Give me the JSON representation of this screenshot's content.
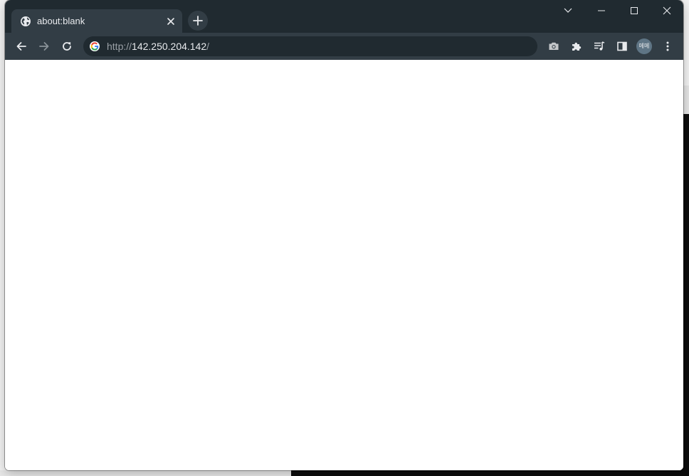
{
  "browser": {
    "tab": {
      "title": "about:blank",
      "favicon": "globe-icon"
    },
    "omnibox": {
      "scheme": "http://",
      "host": "142.250.204.142",
      "path": "/"
    },
    "profile": {
      "initials": "메메"
    },
    "window_controls": [
      "tab-search",
      "minimize",
      "maximize",
      "close"
    ],
    "toolbar_icons": [
      "camera-icon",
      "puzzle-icon",
      "reading-list-icon",
      "side-panel-icon",
      "kebab-menu-icon"
    ]
  },
  "colors": {
    "titlebar": "#202a30",
    "toolbar": "#323d45",
    "omnibox": "#202a30",
    "text": "#e8eaed"
  }
}
